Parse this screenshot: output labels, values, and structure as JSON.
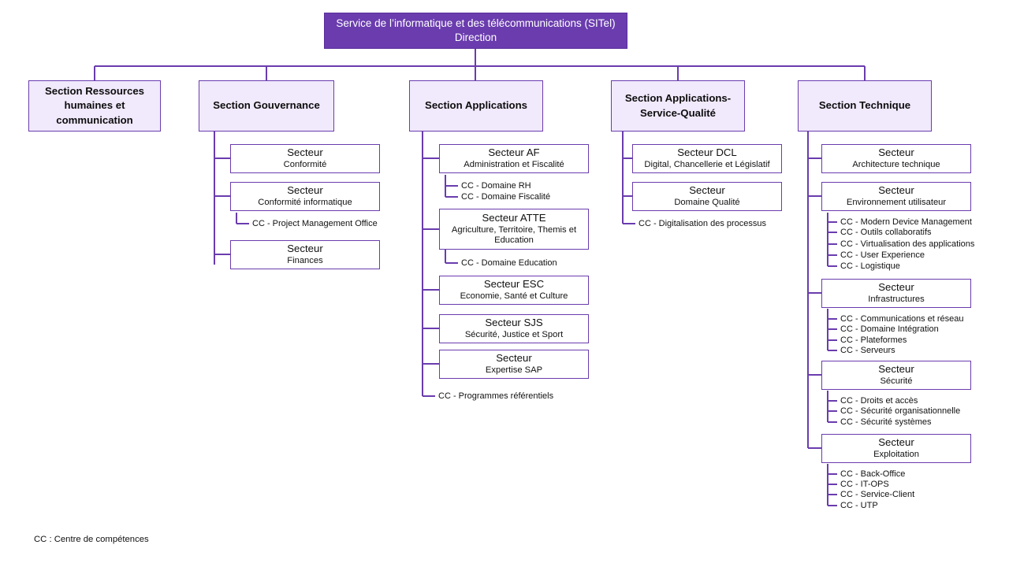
{
  "colors": {
    "root_fill": "#6a3cae",
    "section_fill": "#f1e9fc",
    "border": "#6a3cae",
    "connector": "#6a3cae",
    "connector_light": "#9a7fd0",
    "text_dark": "#111111",
    "text_light": "#ffffff",
    "background": "#ffffff"
  },
  "root": {
    "line1": "Service de l’informatique et des télécommunications (SITel)",
    "line2": "Direction"
  },
  "sections": [
    {
      "id": "ressources-humaines",
      "label": "Section Ressources humaines et communication",
      "lines": [
        "Section Ressources",
        "humaines et",
        "communication"
      ],
      "secteurs": []
    },
    {
      "id": "gouvernance",
      "label": "Section Gouvernance",
      "lines": [
        "Section Gouvernance"
      ],
      "secteurs": [
        {
          "title": "Secteur",
          "sub": "Conformité",
          "cc": []
        },
        {
          "title": "Secteur",
          "sub": "Conformité informatique",
          "cc": [
            "CC - Project Management Office"
          ]
        },
        {
          "title": "Secteur",
          "sub": "Finances",
          "cc": []
        }
      ]
    },
    {
      "id": "applications",
      "label": "Section Applications",
      "lines": [
        "Section Applications"
      ],
      "secteurs": [
        {
          "title": "Secteur AF",
          "sub": "Administration et Fiscalité",
          "cc": [
            "CC - Domaine RH",
            "CC - Domaine Fiscalité"
          ]
        },
        {
          "title": "Secteur ATTE",
          "sub": "Agriculture, Territoire, Themis et Education",
          "cc": [
            "CC - Domaine Education"
          ]
        },
        {
          "title": "Secteur ESC",
          "sub": "Economie, Santé et Culture",
          "cc": []
        },
        {
          "title": "Secteur SJS",
          "sub": "Sécurité, Justice et Sport",
          "cc": []
        },
        {
          "title": "Secteur",
          "sub": "Expertise SAP",
          "cc": []
        }
      ],
      "section_cc": [
        "CC - Programmes référentiels"
      ]
    },
    {
      "id": "applications-service-qualite",
      "label": "Section Applications-Service-Qualité",
      "lines": [
        "Section Applications-",
        "Service-Qualité"
      ],
      "secteurs": [
        {
          "title": "Secteur DCL",
          "sub": "Digital, Chancellerie et Législatif",
          "cc": []
        },
        {
          "title": "Secteur",
          "sub": "Domaine Qualité",
          "cc": []
        }
      ],
      "section_cc": [
        "CC - Digitalisation des processus"
      ]
    },
    {
      "id": "technique",
      "label": "Section Technique",
      "lines": [
        "Section Technique"
      ],
      "secteurs": [
        {
          "title": "Secteur",
          "sub": "Architecture technique",
          "cc": []
        },
        {
          "title": "Secteur",
          "sub": "Environnement utilisateur",
          "cc": [
            "CC - Modern Device Management",
            "CC - Outils collaboratifs",
            "CC - Virtualisation des applications",
            "CC - User Experience",
            "CC - Logistique"
          ]
        },
        {
          "title": "Secteur",
          "sub": "Infrastructures",
          "cc": [
            "CC - Communications et réseau",
            "CC - Domaine Intégration",
            "CC - Plateformes",
            "CC - Serveurs"
          ]
        },
        {
          "title": "Secteur",
          "sub": "Sécurité",
          "cc": [
            "CC - Droits et accès",
            "CC - Sécurité organisationnelle",
            "CC - Sécurité systèmes"
          ]
        },
        {
          "title": "Secteur",
          "sub": "Exploitation",
          "cc": [
            "CC - Back-Office",
            "CC - IT-OPS",
            "CC - Service-Client",
            "CC - UTP"
          ]
        }
      ]
    }
  ],
  "legend": "CC : Centre de compétences"
}
